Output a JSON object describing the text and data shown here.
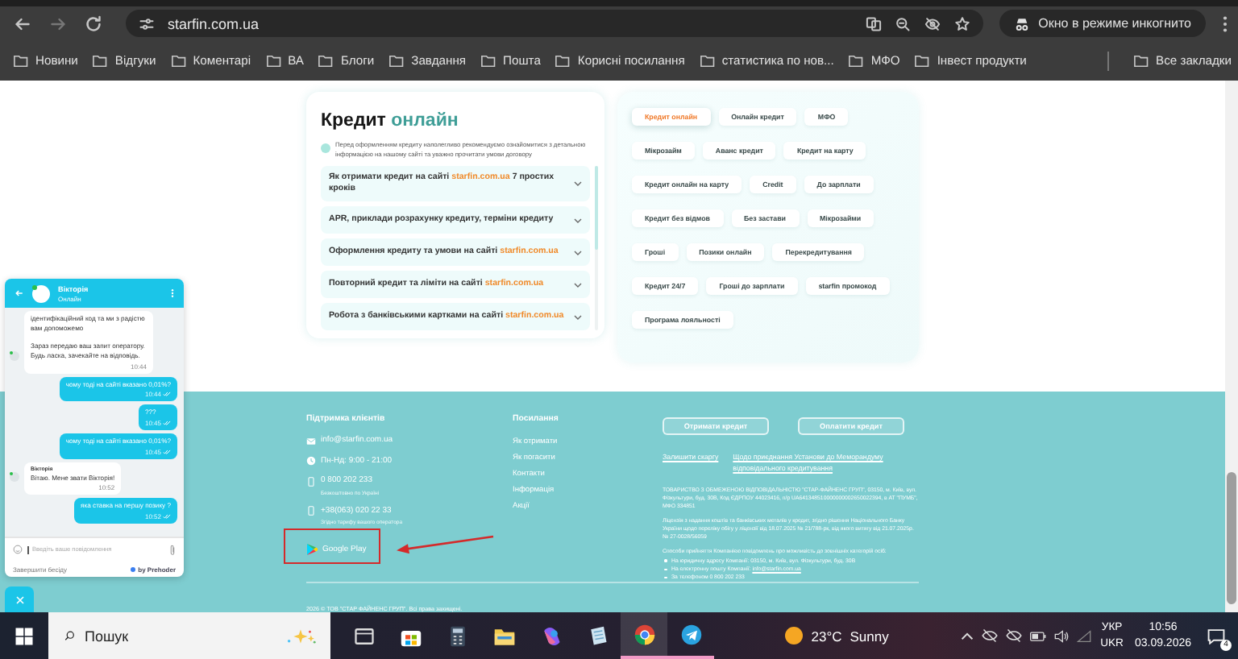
{
  "browser": {
    "url": "starfin.com.ua",
    "incognito_label": "Окно в режиме инкогнито",
    "bookmarks": [
      {
        "label": "Новини"
      },
      {
        "label": "Відгуки"
      },
      {
        "label": "Коментарі"
      },
      {
        "label": "ВА"
      },
      {
        "label": "Блоги"
      },
      {
        "label": "Завдання"
      },
      {
        "label": "Пошта"
      },
      {
        "label": "Корисні посилання"
      },
      {
        "label": "статистика по нов..."
      },
      {
        "label": "МФО"
      },
      {
        "label": "Інвест продукти"
      }
    ],
    "all_bookmarks": "Все закладки"
  },
  "credit_panel": {
    "title": "Кредит",
    "title_accent": "онлайн",
    "note": "Перед оформленням кредиту наполегливо рекомендуємо ознайомитися з детальною інформацією на нашому сайті та уважно прочитати умови договору",
    "faq": [
      {
        "parts": [
          {
            "text": "Як отримати кредит на сайті ",
            "highlight": false
          },
          {
            "text": "starfin.com.ua",
            "highlight": true
          },
          {
            "text": " 7 простих кроків",
            "highlight": false
          }
        ]
      },
      {
        "parts": [
          {
            "text": "APR, приклади розрахунку кредиту, терміни кредиту",
            "highlight": false
          }
        ]
      },
      {
        "parts": [
          {
            "text": "Оформлення кредиту та умови на сайті ",
            "highlight": false
          },
          {
            "text": "starfin.com.ua",
            "highlight": true
          }
        ]
      },
      {
        "parts": [
          {
            "text": "Повторний кредит та ліміти на сайті ",
            "highlight": false
          },
          {
            "text": "starfin.com.ua",
            "highlight": true
          }
        ]
      },
      {
        "parts": [
          {
            "text": "Робота з банківськими картками на сайті ",
            "highlight": false
          },
          {
            "text": "starfin.com.ua",
            "highlight": true
          }
        ]
      }
    ]
  },
  "tags": [
    {
      "label": "Кредит онлайн",
      "selected": true
    },
    {
      "label": "Онлайн кредит",
      "selected": false
    },
    {
      "label": "МФО",
      "selected": false
    },
    {
      "label": "Мікрозайм",
      "selected": false
    },
    {
      "label": "Аванс кредит",
      "selected": false
    },
    {
      "label": "Кредит на карту",
      "selected": false
    },
    {
      "label": "Кредит онлайн на карту",
      "selected": false
    },
    {
      "label": "Credit",
      "selected": false
    },
    {
      "label": "До зарплати",
      "selected": false
    },
    {
      "label": "Кредит без відмов",
      "selected": false
    },
    {
      "label": "Без застави",
      "selected": false
    },
    {
      "label": "Мікрозайми",
      "selected": false
    },
    {
      "label": "Гроші",
      "selected": false
    },
    {
      "label": "Позики онлайн",
      "selected": false
    },
    {
      "label": "Перекредитування",
      "selected": false
    },
    {
      "label": "Кредит 24/7",
      "selected": false
    },
    {
      "label": "Гроші до зарплати",
      "selected": false
    },
    {
      "label": "starfin промокод",
      "selected": false
    },
    {
      "label": "Програма лояльності",
      "selected": false
    }
  ],
  "footer": {
    "support": {
      "heading": "Підтримка клієнтів",
      "contacts": [
        {
          "kind": "email",
          "text": "info@starfin.com.ua"
        },
        {
          "kind": "hours",
          "text": "Пн-Нд: 9:00 - 21:00"
        },
        {
          "kind": "phone",
          "text": "0 800 202 233",
          "note": "Безкоштовно по Україні"
        },
        {
          "kind": "phone",
          "text": "+38(063) 020 22 33",
          "note": "Згідно тарифу вашого оператора"
        }
      ],
      "app_store": "Google Play"
    },
    "links": {
      "heading": "Посилання",
      "items": [
        "Як отримати",
        "Як погасити",
        "Контакти",
        "Інформація",
        "Акції"
      ]
    },
    "buttons": [
      "Отримати кредит",
      "Оплатити кредит"
    ],
    "legal_links": [
      "Залишити скаргу",
      "Щодо приєднання Установи до Меморандуму відповідального кредитування"
    ],
    "legal_paragraphs": [
      "ТОВАРИСТВО З ОБМЕЖЕНОЮ ВІДПОВІДАЛЬНІСТЮ \"СТАР-ФАЙНЕНС ГРУП\", 03150, м. Київ, вул. Фізкультури, буд. 30В, Код ЄДРПОУ 44023416, п/р UA641348510000000002650022394, в АТ \"ПУМБ\", МФО 334851",
      "Ліцензія з надання коштів та банківських металів у кредит, згідно рішення Національного Банку України щодо переліку обігу у ліцензії від 18.07.2025 № 21/788-рк, від якого витягу від 21.07.2025р. № 27-0028/56059"
    ],
    "channels_intro": "Способи прийняття Компанією повідомлень про можливість до зовнішніх категорій осіб:",
    "channels": [
      {
        "text": "На юридичну адресу Компанії: 03150, м. Київ, вул. Фізкультури, буд. 30В"
      },
      {
        "text": "На електронну пошту Компанії: ",
        "link": "info@starfin.com.ua"
      },
      {
        "text": "За телефоном 0 800 202 233"
      }
    ],
    "copyright": "2026 © ТОВ \"СТАР ФАЙНЕНС ГРУП\". Всі права захищені."
  },
  "chat": {
    "agent": "Вікторія",
    "status": "Онлайн",
    "messages": [
      {
        "kind": "incoming",
        "text": "ідентифікаційний код та ми з радістю вам допоможемо\n\nЗараз передаю ваш запит оператору. Будь ласка, зачекайте на відповідь.",
        "time": "10:44"
      },
      {
        "kind": "outgoing",
        "text": "чому тоді на сайті вказано 0,01%?",
        "time": "10:44"
      },
      {
        "kind": "outgoing",
        "text": "???",
        "time": "10:45"
      },
      {
        "kind": "outgoing",
        "text": "чому тоді на сайті вказано 0,01%?",
        "time": "10:45"
      },
      {
        "kind": "incoming",
        "sender": "Вікторія",
        "text": "Вітаю. Мене звати Вікторія!",
        "time": "10:52"
      },
      {
        "kind": "outgoing",
        "text": "яка ставка на першу позику ?",
        "time": "10:52"
      }
    ],
    "placeholder": "Введіть ваше повідомлення",
    "end_label": "Завершити бесіду",
    "brand": "by Prehoder"
  },
  "taskbar": {
    "search_placeholder": "Пошук",
    "temperature": "23°C",
    "weather": "Sunny",
    "language": [
      "УКР",
      "UKR"
    ],
    "time": "10:56",
    "date": "03.09.2026",
    "notifications": "4"
  }
}
